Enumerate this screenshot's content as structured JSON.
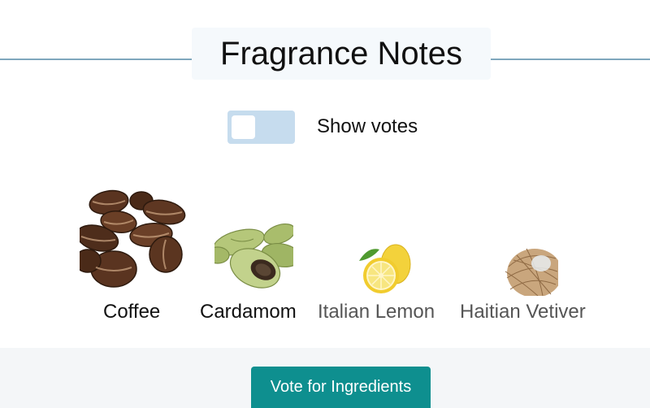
{
  "header": {
    "title": "Fragrance Notes"
  },
  "toggle": {
    "label": "Show votes",
    "on": false
  },
  "notes": [
    {
      "label": "Coffee",
      "icon": "coffee-beans-image",
      "text_color": "#111111"
    },
    {
      "label": "Cardamom",
      "icon": "cardamom-image",
      "text_color": "#111111"
    },
    {
      "label": "Italian Lemon",
      "icon": "lemon-image",
      "text_color": "#555555"
    },
    {
      "label": "Haitian Vetiver",
      "icon": "vetiver-image",
      "text_color": "#555555"
    }
  ],
  "actions": {
    "vote_button": "Vote for Ingredients"
  },
  "colors": {
    "accent": "#0e8f8f",
    "divider": "#7fa7bd",
    "toggle_track": "#c6dcee"
  }
}
